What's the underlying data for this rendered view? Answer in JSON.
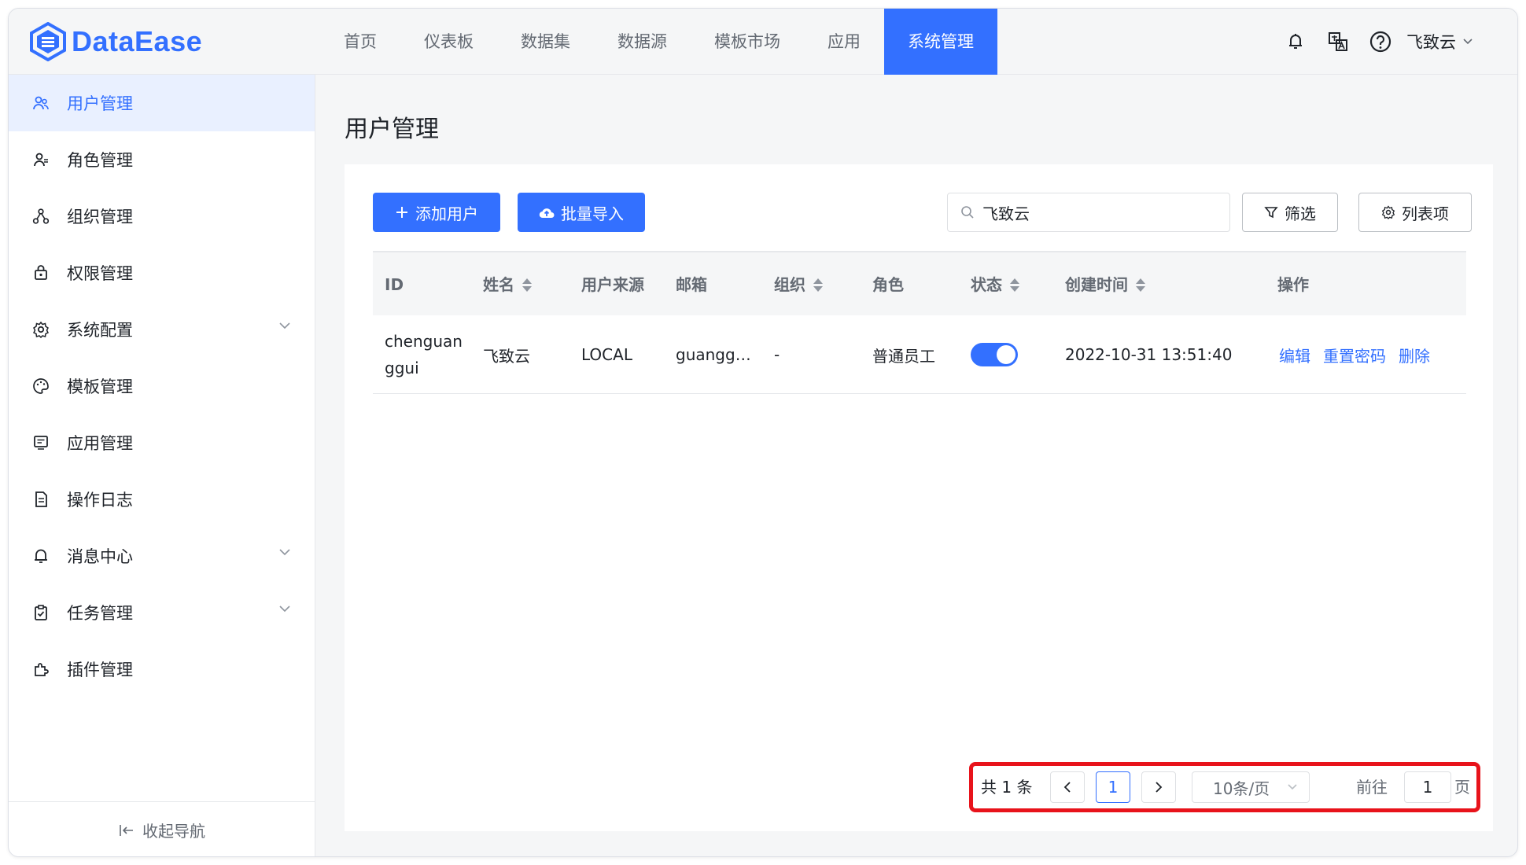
{
  "app": {
    "logo_text": "DataEase",
    "brand_color": "#3370ff"
  },
  "topnav": {
    "items": [
      {
        "label": "首页"
      },
      {
        "label": "仪表板"
      },
      {
        "label": "数据集"
      },
      {
        "label": "数据源"
      },
      {
        "label": "模板市场"
      },
      {
        "label": "应用"
      },
      {
        "label": "系统管理",
        "active": true
      }
    ],
    "user": "飞致云",
    "icons": [
      "bell-icon",
      "translate-icon",
      "help-icon"
    ]
  },
  "sidebar": {
    "items": [
      {
        "label": "用户管理",
        "icon": "users-icon",
        "active": true
      },
      {
        "label": "角色管理",
        "icon": "role-icon"
      },
      {
        "label": "组织管理",
        "icon": "org-icon"
      },
      {
        "label": "权限管理",
        "icon": "lock-icon"
      },
      {
        "label": "系统配置",
        "icon": "gear-icon",
        "expandable": true
      },
      {
        "label": "模板管理",
        "icon": "palette-icon"
      },
      {
        "label": "应用管理",
        "icon": "app-icon"
      },
      {
        "label": "操作日志",
        "icon": "log-icon"
      },
      {
        "label": "消息中心",
        "icon": "bell-icon",
        "expandable": true
      },
      {
        "label": "任务管理",
        "icon": "task-icon",
        "expandable": true
      },
      {
        "label": "插件管理",
        "icon": "plugin-icon"
      }
    ],
    "collapse_label": "收起导航"
  },
  "page": {
    "title": "用户管理",
    "add_user": "添加用户",
    "batch_import": "批量导入",
    "search_value": "飞致云",
    "filter": "筛选",
    "columns_btn": "列表项"
  },
  "table": {
    "headers": [
      "ID",
      "姓名",
      "用户来源",
      "邮箱",
      "组织",
      "角色",
      "状态",
      "创建时间",
      "操作"
    ],
    "rows": [
      {
        "id": "chenguanggui",
        "name": "飞致云",
        "source": "LOCAL",
        "email": "guangg…",
        "org": "-",
        "role": "普通员工",
        "enabled": true,
        "created": "2022-10-31 13:51:40",
        "actions": [
          "编辑",
          "重置密码",
          "删除"
        ]
      }
    ]
  },
  "pagination": {
    "total": "共 1 条",
    "current_page": "1",
    "page_size": "10条/页",
    "goto_label": "前往",
    "goto_value": "1",
    "page_suffix": "页"
  }
}
